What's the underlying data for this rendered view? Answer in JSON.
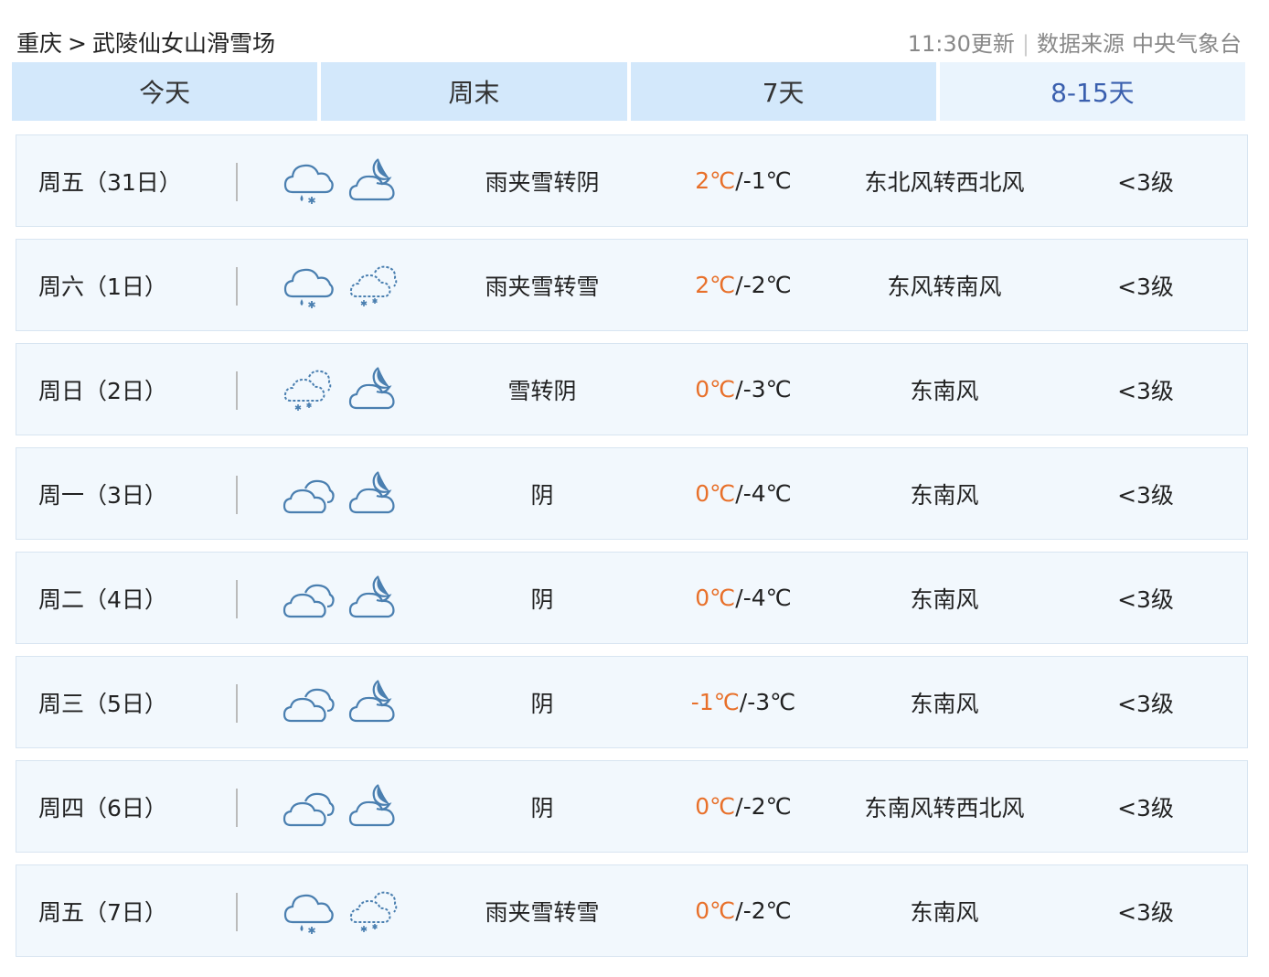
{
  "header": {
    "breadcrumb": {
      "city": "重庆",
      "separator": ">",
      "place": "武陵仙女山滑雪场"
    },
    "update_time": "11:30更新",
    "source_label": "数据来源",
    "source_name": "中央气象台"
  },
  "tabs": [
    {
      "label": "今天",
      "active": false
    },
    {
      "label": "周末",
      "active": false
    },
    {
      "label": "7天",
      "active": false
    },
    {
      "label": "8-15天",
      "active": true
    }
  ],
  "colors": {
    "tab_bg": "#d3e8fb",
    "tab_active_bg": "#eaf4fd",
    "tab_active_text": "#3a5fae",
    "high_temp": "#e8702a",
    "row_bg": "#f2f8fd",
    "icon_stroke": "#4a7fb0"
  },
  "forecast": [
    {
      "day": "周五（31日）",
      "icon_day": "sleet-icon",
      "icon_night": "cloudy-night-icon",
      "desc": "雨夹雪转阴",
      "high": "2℃",
      "low": "/-1℃",
      "wind": "东北风转西北风",
      "level": "<3级"
    },
    {
      "day": "周六（1日）",
      "icon_day": "sleet-icon",
      "icon_night": "snow-icon",
      "desc": "雨夹雪转雪",
      "high": "2℃",
      "low": "/-2℃",
      "wind": "东风转南风",
      "level": "<3级"
    },
    {
      "day": "周日（2日）",
      "icon_day": "snow-icon",
      "icon_night": "cloudy-night-icon",
      "desc": "雪转阴",
      "high": "0℃",
      "low": "/-3℃",
      "wind": "东南风",
      "level": "<3级"
    },
    {
      "day": "周一（3日）",
      "icon_day": "overcast-icon",
      "icon_night": "cloudy-night-icon",
      "desc": "阴",
      "high": "0℃",
      "low": "/-4℃",
      "wind": "东南风",
      "level": "<3级"
    },
    {
      "day": "周二（4日）",
      "icon_day": "overcast-icon",
      "icon_night": "cloudy-night-icon",
      "desc": "阴",
      "high": "0℃",
      "low": "/-4℃",
      "wind": "东南风",
      "level": "<3级"
    },
    {
      "day": "周三（5日）",
      "icon_day": "overcast-icon",
      "icon_night": "cloudy-night-icon",
      "desc": "阴",
      "high": "-1℃",
      "low": "/-3℃",
      "wind": "东南风",
      "level": "<3级"
    },
    {
      "day": "周四（6日）",
      "icon_day": "overcast-icon",
      "icon_night": "cloudy-night-icon",
      "desc": "阴",
      "high": "0℃",
      "low": "/-2℃",
      "wind": "东南风转西北风",
      "level": "<3级"
    },
    {
      "day": "周五（7日）",
      "icon_day": "sleet-icon",
      "icon_night": "snow-icon",
      "desc": "雨夹雪转雪",
      "high": "0℃",
      "low": "/-2℃",
      "wind": "东南风",
      "level": "<3级"
    }
  ]
}
